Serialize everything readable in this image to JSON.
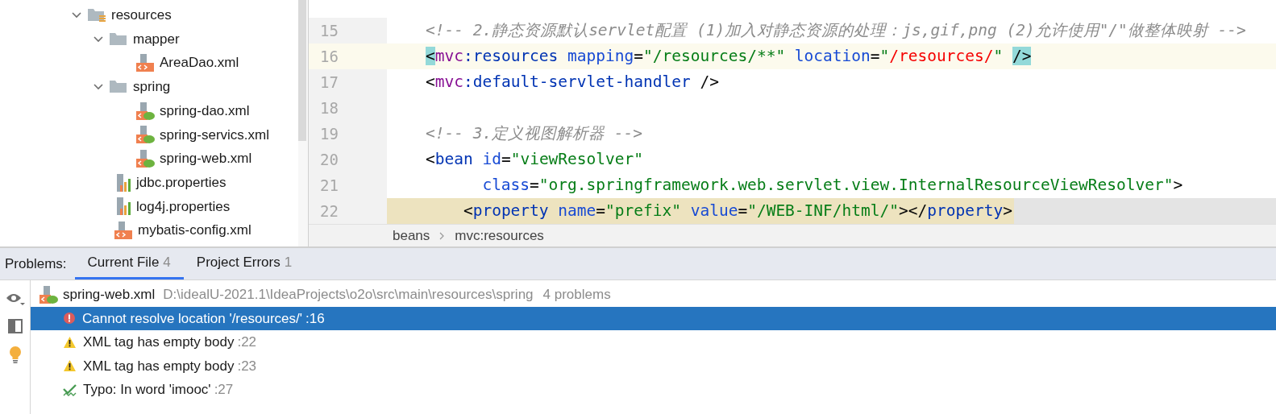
{
  "project_tree": {
    "items": [
      {
        "name": "resources",
        "kind": "resources-folder",
        "expanded": true,
        "children": [
          {
            "name": "mapper",
            "kind": "folder",
            "expanded": true,
            "children": [
              {
                "name": "AreaDao.xml",
                "kind": "xml"
              }
            ]
          },
          {
            "name": "spring",
            "kind": "folder",
            "expanded": true,
            "children": [
              {
                "name": "spring-dao.xml",
                "kind": "spring-xml"
              },
              {
                "name": "spring-servics.xml",
                "kind": "spring-xml"
              },
              {
                "name": "spring-web.xml",
                "kind": "spring-xml"
              }
            ]
          },
          {
            "name": "jdbc.properties",
            "kind": "properties"
          },
          {
            "name": "log4j.properties",
            "kind": "properties"
          },
          {
            "name": "mybatis-config.xml",
            "kind": "xml"
          }
        ]
      }
    ]
  },
  "editor": {
    "lines": [
      {
        "number": "15",
        "current": false,
        "marked": false,
        "tokens": [
          {
            "t": "<!-- 2.静态资源默认servlet配置 (1)加入对静态资源的处理：js,gif,png (2)允许使用\"/\"做整体映射 -->",
            "kind": "comment"
          }
        ]
      },
      {
        "number": "16",
        "current": true,
        "marked": false,
        "tokens": [
          {
            "t": "<",
            "kind": "match"
          },
          {
            "t": "mvc",
            "kind": "ns"
          },
          {
            "t": ":resources",
            "kind": "tag"
          },
          {
            "t": " mapping",
            "kind": "attr"
          },
          {
            "t": "=",
            "kind": "text"
          },
          {
            "t": "\"/resources/**\"",
            "kind": "str"
          },
          {
            "t": " location",
            "kind": "attr"
          },
          {
            "t": "=",
            "kind": "text"
          },
          {
            "t": "\"",
            "kind": "str"
          },
          {
            "t": "/resources/",
            "kind": "error"
          },
          {
            "t": "\" ",
            "kind": "str"
          },
          {
            "t": "/>",
            "kind": "match"
          }
        ]
      },
      {
        "number": "17",
        "current": false,
        "marked": false,
        "tokens": [
          {
            "t": "<",
            "kind": "text"
          },
          {
            "t": "mvc",
            "kind": "ns"
          },
          {
            "t": ":default-servlet-handler",
            "kind": "tag"
          },
          {
            "t": " />",
            "kind": "text"
          }
        ]
      },
      {
        "number": "18",
        "current": false,
        "marked": false
      },
      {
        "number": "19",
        "current": false,
        "marked": false,
        "tokens": [
          {
            "t": "<!-- 3.定义视图解析器 -->",
            "kind": "comment"
          }
        ]
      },
      {
        "number": "20",
        "current": false,
        "marked": false,
        "tokens": [
          {
            "t": "<",
            "kind": "text"
          },
          {
            "t": "bean",
            "kind": "tag"
          },
          {
            "t": " id",
            "kind": "attr"
          },
          {
            "t": "=",
            "kind": "text"
          },
          {
            "t": "\"viewResolver\"",
            "kind": "str"
          }
        ]
      },
      {
        "number": "21",
        "current": false,
        "marked": false,
        "tokens": [
          {
            "t": "      class",
            "kind": "attr"
          },
          {
            "t": "=",
            "kind": "text"
          },
          {
            "t": "\"org.springframework.web.servlet.view.InternalResourceViewResolver\"",
            "kind": "str"
          },
          {
            "t": ">",
            "kind": "text"
          }
        ]
      },
      {
        "number": "22",
        "current": false,
        "marked": true,
        "tokens": [
          {
            "t": "    <",
            "kind": "text"
          },
          {
            "t": "property",
            "kind": "tag"
          },
          {
            "t": " name",
            "kind": "attr"
          },
          {
            "t": "=",
            "kind": "text"
          },
          {
            "t": "\"prefix\"",
            "kind": "str"
          },
          {
            "t": " value",
            "kind": "attr"
          },
          {
            "t": "=",
            "kind": "text"
          },
          {
            "t": "\"/WEB-INF/html/\"",
            "kind": "str"
          },
          {
            "t": "></",
            "kind": "text"
          },
          {
            "t": "property",
            "kind": "tag"
          },
          {
            "t": ">",
            "kind": "text"
          }
        ]
      }
    ],
    "breadcrumb": [
      "beans",
      "mvc:resources"
    ]
  },
  "problems": {
    "label": "Problems:",
    "tabs": [
      {
        "label": "Current File",
        "count": "4",
        "selected": true
      },
      {
        "label": "Project Errors",
        "count": "1",
        "selected": false
      }
    ],
    "file": {
      "name": "spring-web.xml",
      "path": "D:\\idealU-2021.1\\IdeaProjects\\o2o\\src\\main\\resources\\spring",
      "summary": "4 problems"
    },
    "items": [
      {
        "kind": "error",
        "text": "Cannot resolve location '/resources/'",
        "line": ":16",
        "selected": true
      },
      {
        "kind": "warning",
        "text": "XML tag has empty body",
        "line": ":22",
        "selected": false
      },
      {
        "kind": "warning",
        "text": "XML tag has empty body",
        "line": ":23",
        "selected": false
      },
      {
        "kind": "typo",
        "text": "Typo: In word 'imooc'",
        "line": ":27",
        "selected": false
      }
    ]
  }
}
